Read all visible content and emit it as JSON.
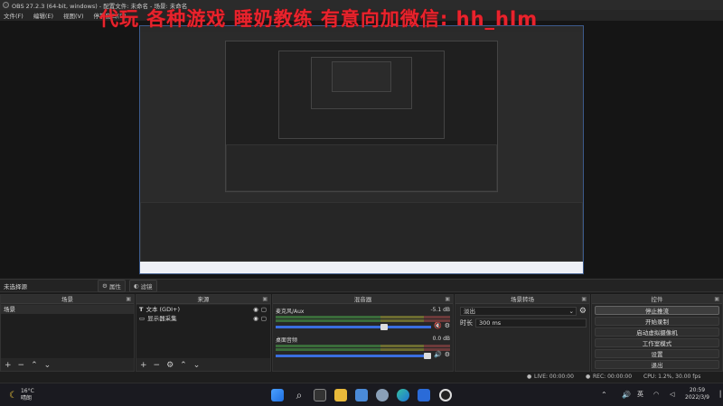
{
  "window": {
    "title": "OBS 27.2.3 (64-bit, windows) - 配置文件: 未命名 - 场景: 未命名"
  },
  "menu": [
    "文件(F)",
    "编辑(E)",
    "视图(V)",
    "停靠窗口(D)"
  ],
  "overlay_text": "代玩 各种游戏 睡奶教练 有意向加微信: hh_hlm",
  "sourcebar": {
    "no_source": "未选择源",
    "properties": "属性",
    "filters": "滤镜"
  },
  "scenes": {
    "title": "场景",
    "items": [
      "场景"
    ]
  },
  "sources": {
    "title": "来源",
    "items": [
      {
        "label": "文本 (GDI+)"
      },
      {
        "label": "显示器采集"
      }
    ]
  },
  "mixer": {
    "title": "混音器",
    "channels": [
      {
        "name": "麦克风/Aux",
        "db": "-5.1 dB",
        "volume_fraction": 0.72
      },
      {
        "name": "桌面音频",
        "db": "0.0 dB",
        "volume_fraction": 1.0
      }
    ]
  },
  "transitions": {
    "title": "场景转场",
    "current": "淡出",
    "duration_label": "时长",
    "duration": "300 ms"
  },
  "controls": {
    "title": "控件",
    "buttons": [
      "停止推流",
      "开始录制",
      "启动虚拟摄像机",
      "工作室模式",
      "设置",
      "退出"
    ]
  },
  "status": {
    "live": "LIVE: 00:00:00",
    "rec": "REC: 00:00:00",
    "cpu": "CPU: 1.2%, 30.00 fps"
  },
  "taskbar": {
    "temp": "16°C",
    "weather": "晴朗",
    "lang": "英",
    "time": "20:59",
    "date": "2022/3/9"
  },
  "colors": {
    "accent": "#3a6ee0",
    "overlay": "#e8232d"
  }
}
